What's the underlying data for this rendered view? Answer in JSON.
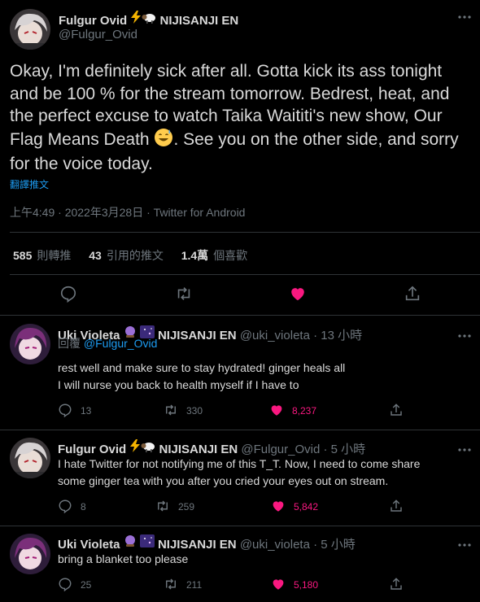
{
  "colors": {
    "background": "#000000",
    "text": "#d9d9d9",
    "muted": "#6e767d",
    "link": "#1d9bf0",
    "like": "#f91880",
    "border": "#2f3336"
  },
  "main_tweet": {
    "author_name": "Fulgur Ovid",
    "author_suffix": "NIJISANJI EN",
    "handle": "@Fulgur_Ovid",
    "text_before_emoji": "Okay, I'm definitely sick after all. Gotta kick its ass tonight and be 100 % for the stream tomorrow. Bedrest, heat, and the perfect excuse to watch Taika Waititi's new show, Our Flag Means Death",
    "text_after_emoji": ". See you on the other side, and sorry for the voice today.",
    "translate_label": "翻譯推文",
    "timestamp": "上午4:49 · 2022年3月28日 · Twitter for Android",
    "retweets_count": "585",
    "retweets_label": "則轉推",
    "quotes_count": "43",
    "quotes_label": "引用的推文",
    "likes_count": "1.4萬",
    "likes_label": "個喜歡",
    "icons": [
      "reply-icon",
      "retweet-icon",
      "like-icon",
      "share-icon",
      "more-icon",
      "lightning-emoji",
      "sheep-emoji",
      "sweat-smile-emoji"
    ]
  },
  "replies": [
    {
      "author_name": "Uki Violeta",
      "author_suffix": "NIJISANJI EN",
      "handle": "@uki_violeta",
      "time": "· 13 小時",
      "replying_prefix": "回覆",
      "replying_to": "@Fulgur_Ovid",
      "line1": "rest well and make sure to stay hydrated! ginger heals all",
      "line2": "I will nurse you back to health myself if I have to",
      "reply_count": "13",
      "retweet_count": "330",
      "like_count": "8,237"
    },
    {
      "author_name": "Fulgur Ovid",
      "author_suffix": "NIJISANJI EN",
      "handle": "@Fulgur_Ovid",
      "time": "· 5 小時",
      "line1": "I hate Twitter for not notifying me of this T_T. Now, I need to come share",
      "line2": "some ginger tea with you after you cried your eyes out on stream.",
      "reply_count": "8",
      "retweet_count": "259",
      "like_count": "5,842"
    },
    {
      "author_name": "Uki Violeta",
      "author_suffix": "NIJISANJI EN",
      "handle": "@uki_violeta",
      "time": "· 5 小時",
      "line1": "bring a blanket too please",
      "reply_count": "25",
      "retweet_count": "211",
      "like_count": "5,180"
    }
  ]
}
